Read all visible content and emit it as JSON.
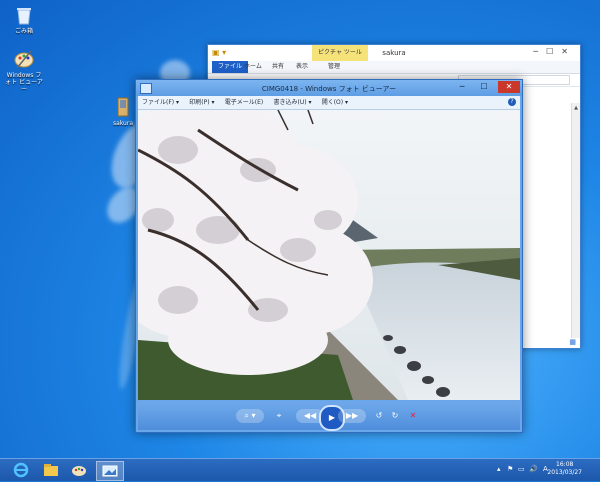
{
  "desktop": {
    "icons": [
      {
        "label": "ごみ箱",
        "icon": "recycle-bin-icon"
      },
      {
        "label": "Windows フォト ビューアー",
        "icon": "paint-palette-icon"
      },
      {
        "label": "sakura",
        "icon": "folder-icon"
      }
    ]
  },
  "explorer": {
    "title": "sakura",
    "context_tab": "ピクチャ ツール",
    "ribbon_tabs": [
      "ファイル",
      "ホーム",
      "共有",
      "表示",
      "管理"
    ],
    "active_tab": "ファイル"
  },
  "viewer": {
    "title": "CIMG0418 - Windows フォト ビューアー",
    "menu": [
      "ファイル(F) ▾",
      "印刷(P) ▾",
      "電子メール(E)",
      "書き込み(U) ▾",
      "開く(O) ▾"
    ],
    "help": "?",
    "close_glyph": "✕",
    "minimize_glyph": "─",
    "maximize_glyph": "☐",
    "toolbar": {
      "zoom": "⌕ ▾",
      "fit": "⌖",
      "prev": "◀◀",
      "play": "▶",
      "next": "▶▶",
      "rotate_ccw": "↺",
      "rotate_cw": "↻",
      "delete": "✕"
    }
  },
  "taskbar": {
    "apps": [
      "internet-explorer-icon",
      "file-explorer-icon",
      "paint-icon",
      "photo-viewer-icon"
    ],
    "tray": [
      "▴",
      "⚑",
      "▭",
      "🔊",
      "A"
    ],
    "time": "16:08",
    "date": "2013/03/27"
  },
  "colors": {
    "accent": "#1e5fc8",
    "close": "#c9382a",
    "desktop": "#1e86e6"
  }
}
